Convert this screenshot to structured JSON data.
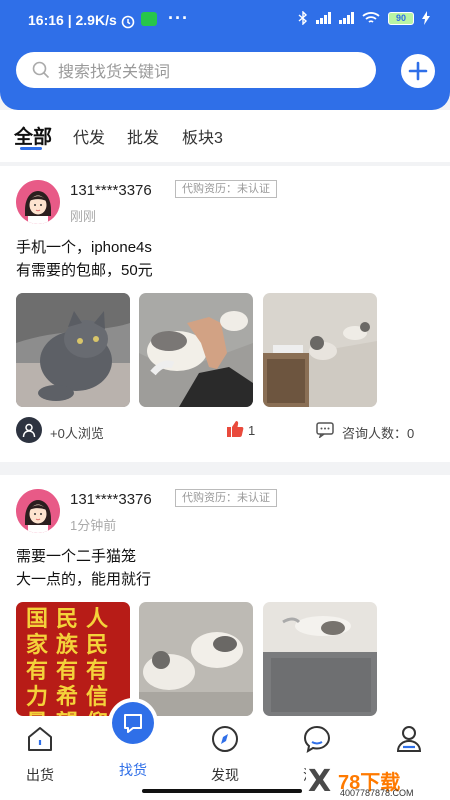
{
  "status_bar": {
    "time_speed": "16:16 | 2.9K/s",
    "dots": "···",
    "battery": "90"
  },
  "search": {
    "placeholder": "搜索找货关键词"
  },
  "tabs": [
    {
      "label": "全部",
      "active": true
    },
    {
      "label": "代发"
    },
    {
      "label": "批发"
    },
    {
      "label": "板块3"
    }
  ],
  "posts": [
    {
      "username": "131****3376",
      "badge": "代购资历：未认证",
      "time": "刚刚",
      "content_line1": "手机一个，iphone4s",
      "content_line2": "有需要的包邮，50元",
      "views": "+0人浏览",
      "likes": "1",
      "consult": "咨询人数：0"
    },
    {
      "username": "131****3376",
      "badge": "代购资历：未认证",
      "time": "1分钟前",
      "content_line1": "需要一个二手猫笼",
      "content_line2": "大一点的，能用就行",
      "poster_text": [
        "国",
        "民",
        "人",
        "家",
        "族",
        "民",
        "有",
        "有",
        "有",
        "力",
        "希",
        "信",
        "量",
        "望",
        "仰"
      ]
    }
  ],
  "bottom_nav": [
    {
      "label": "出货"
    },
    {
      "label": "找货",
      "active": true
    },
    {
      "label": "发现"
    },
    {
      "label": "消息"
    },
    {
      "label": "我的"
    }
  ],
  "watermark": {
    "main": "78下载",
    "sub": "4007787878.COM"
  },
  "colors": {
    "primary": "#2f6fe8",
    "like": "#e94a3c"
  }
}
